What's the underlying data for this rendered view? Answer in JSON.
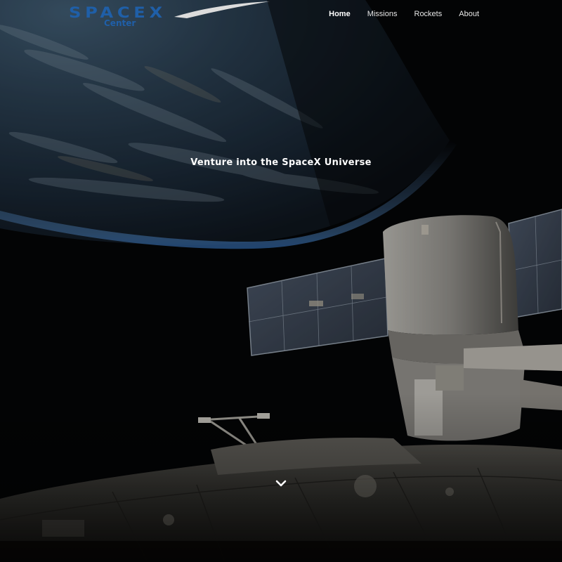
{
  "brand": {
    "name": "SPACEX",
    "subtitle": "Center",
    "color": "#1f5fa8"
  },
  "nav": {
    "items": [
      {
        "label": "Home",
        "active": true
      },
      {
        "label": "Missions",
        "active": false
      },
      {
        "label": "Rockets",
        "active": false
      },
      {
        "label": "About",
        "active": false
      }
    ]
  },
  "hero": {
    "headline": "Venture into the SpaceX Universe",
    "background_icon": "earth-and-space-station-image",
    "scroll_icon": "chevron-down-icon"
  }
}
